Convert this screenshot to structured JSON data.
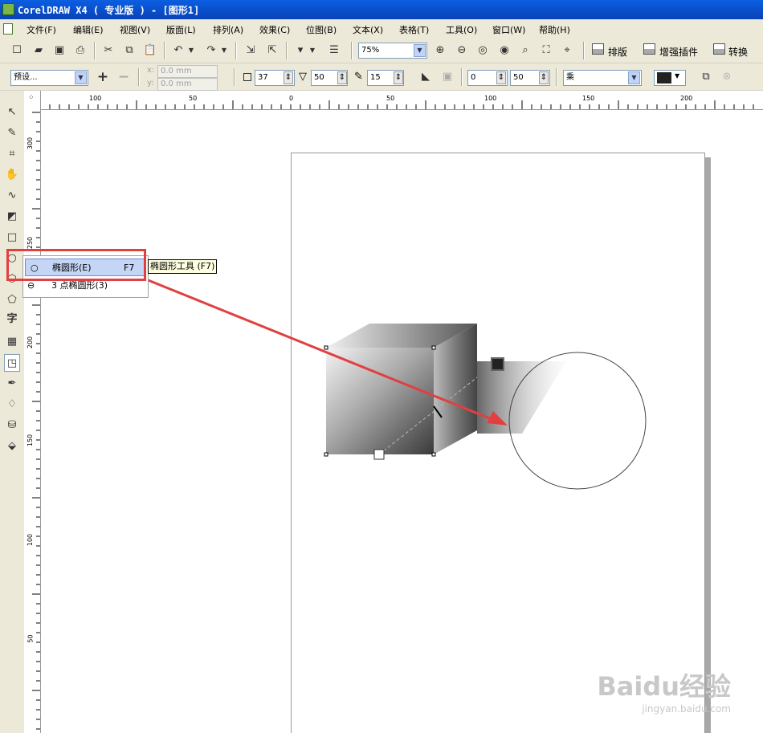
{
  "window": {
    "title": "CorelDRAW X4 ( 专业版 ) - [图形1]"
  },
  "menu": [
    "文件(F)",
    "编辑(E)",
    "视图(V)",
    "版面(L)",
    "排列(A)",
    "效果(C)",
    "位图(B)",
    "文本(X)",
    "表格(T)",
    "工具(O)",
    "窗口(W)",
    "帮助(H)"
  ],
  "toolbar": {
    "zoom": "75%",
    "layout_label": "排版",
    "plugin_label": "增强插件",
    "convert_label": "转换"
  },
  "property_bar": {
    "preset": "预设...",
    "x_label": "x:",
    "x_value": "0.0 mm",
    "y_label": "y:",
    "y_value": "0.0 mm",
    "offset_a": "37",
    "offset_b": "50",
    "offset_c": "15",
    "opacity_start": "0",
    "opacity_end": "50",
    "merge_mode": "乘"
  },
  "ruler": {
    "h_ticks": [
      "100",
      "50",
      "0",
      "50",
      "100",
      "150",
      "200"
    ],
    "v_ticks": [
      "300",
      "250",
      "200",
      "150",
      "100",
      "50"
    ]
  },
  "flyout": {
    "items": [
      {
        "label": "椭圆形(E)",
        "shortcut": "F7"
      },
      {
        "label": "3 点椭圆形(3)",
        "shortcut": ""
      }
    ],
    "tooltip": "椭圆形工具 (F7)"
  },
  "toolbox": {
    "text_tool_glyph": "字"
  },
  "watermark": {
    "brand": "Baidu经验",
    "url": "jingyan.baidu.com"
  },
  "colors": {
    "annotation": "#e0403f",
    "titlebar": "#0a5fe0"
  }
}
